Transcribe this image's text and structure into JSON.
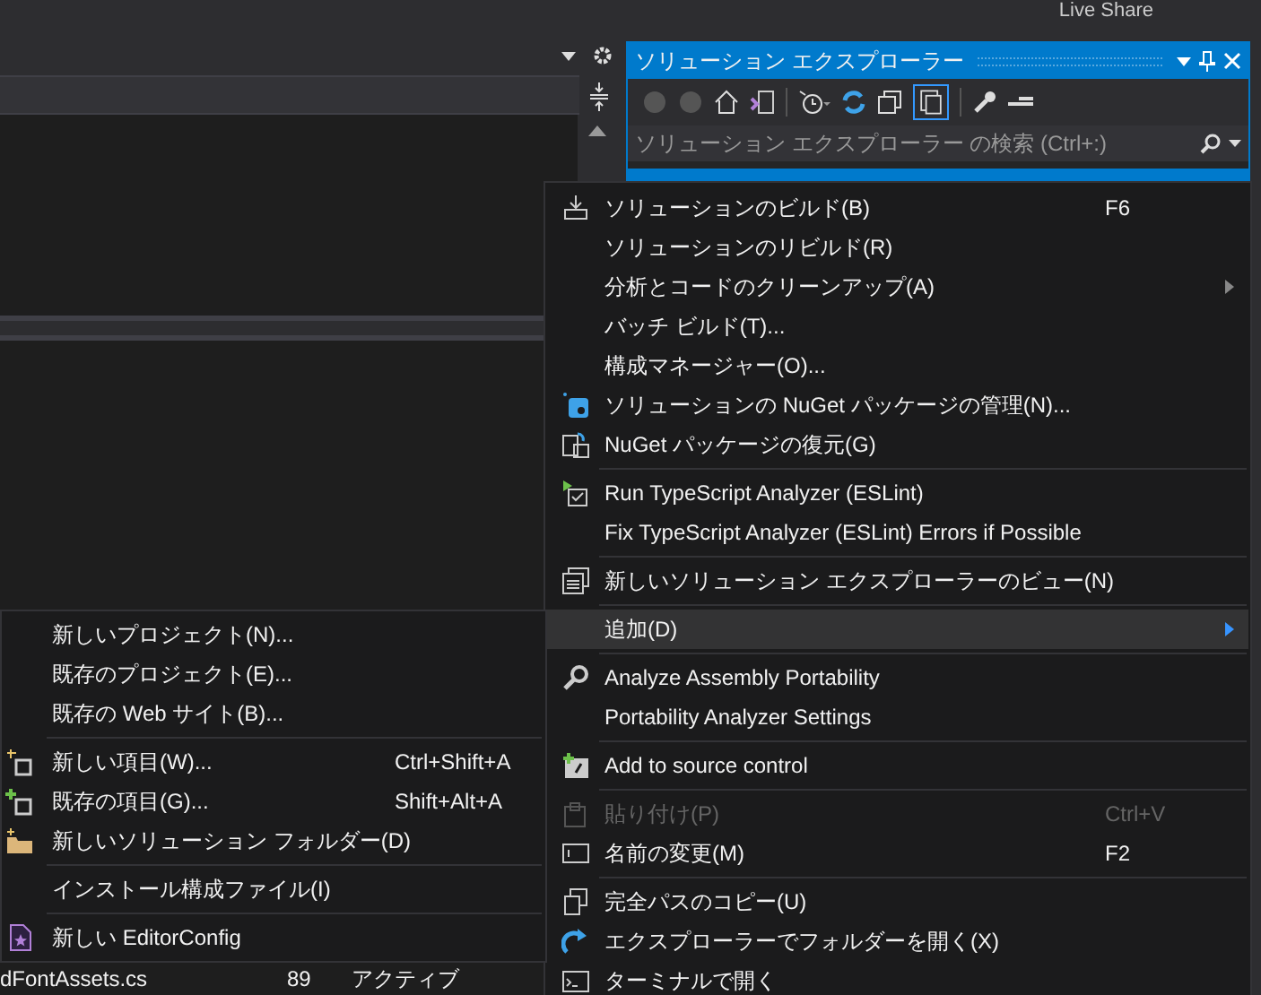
{
  "top_bar": {
    "live_share": "Live Share"
  },
  "solution_explorer": {
    "title": "ソリューション エクスプローラー",
    "search": {
      "placeholder": "ソリューション エクスプローラー の検索 (Ctrl+:)"
    }
  },
  "context_menu": {
    "groups": [
      [
        {
          "label": "ソリューションのビルド(B)",
          "shortcut": "F6",
          "disabled": false,
          "highlighted": false,
          "submenu": false
        },
        {
          "label": "ソリューションのリビルド(R)",
          "disabled": false,
          "highlighted": false,
          "submenu": false
        },
        {
          "label": "分析とコードのクリーンアップ(A)",
          "disabled": false,
          "highlighted": false,
          "submenu": true
        },
        {
          "label": "バッチ ビルド(T)...",
          "disabled": false,
          "highlighted": false,
          "submenu": false
        },
        {
          "label": "構成マネージャー(O)...",
          "disabled": false,
          "highlighted": false,
          "submenu": false
        },
        {
          "label": "ソリューションの NuGet パッケージの管理(N)...",
          "disabled": false,
          "highlighted": false,
          "submenu": false
        },
        {
          "label": "NuGet パッケージの復元(G)",
          "disabled": false,
          "highlighted": false,
          "submenu": false
        }
      ],
      [
        {
          "label": "Run TypeScript Analyzer (ESLint)",
          "disabled": false,
          "highlighted": false,
          "submenu": false
        },
        {
          "label": "Fix TypeScript Analyzer (ESLint) Errors if Possible",
          "disabled": false,
          "highlighted": false,
          "submenu": false
        }
      ],
      [
        {
          "label": "新しいソリューション エクスプローラーのビュー(N)",
          "disabled": false,
          "highlighted": false,
          "submenu": false
        }
      ],
      [
        {
          "label": "追加(D)",
          "disabled": false,
          "highlighted": true,
          "submenu": true
        }
      ],
      [
        {
          "label": "Analyze Assembly Portability",
          "disabled": false,
          "highlighted": false,
          "submenu": false
        },
        {
          "label": "Portability Analyzer Settings",
          "disabled": false,
          "highlighted": false,
          "submenu": false
        }
      ],
      [
        {
          "label": "Add to source control",
          "disabled": false,
          "highlighted": false,
          "submenu": false
        }
      ],
      [
        {
          "label": "貼り付け(P)",
          "shortcut": "Ctrl+V",
          "disabled": true,
          "highlighted": false,
          "submenu": false
        },
        {
          "label": "名前の変更(M)",
          "shortcut": "F2",
          "disabled": false,
          "highlighted": false,
          "submenu": false
        }
      ],
      [
        {
          "label": "完全パスのコピー(U)",
          "disabled": false,
          "highlighted": false,
          "submenu": false
        },
        {
          "label": "エクスプローラーでフォルダーを開く(X)",
          "disabled": false,
          "highlighted": false,
          "submenu": false
        },
        {
          "label": "ターミナルで開く",
          "disabled": false,
          "highlighted": false,
          "submenu": false
        }
      ]
    ]
  },
  "add_submenu": {
    "groups": [
      [
        {
          "label": "新しいプロジェクト(N)..."
        },
        {
          "label": "既存のプロジェクト(E)..."
        },
        {
          "label": "既存の Web サイト(B)..."
        }
      ],
      [
        {
          "label": "新しい項目(W)...",
          "shortcut": "Ctrl+Shift+A"
        },
        {
          "label": "既存の項目(G)...",
          "shortcut": "Shift+Alt+A"
        },
        {
          "label": "新しいソリューション フォルダー(D)"
        }
      ],
      [
        {
          "label": "インストール構成ファイル(I)"
        }
      ],
      [
        {
          "label": "新しい EditorConfig"
        }
      ]
    ]
  },
  "error_row": {
    "file": "dFontAssets.cs",
    "line": "89",
    "state": "アクティブ"
  }
}
